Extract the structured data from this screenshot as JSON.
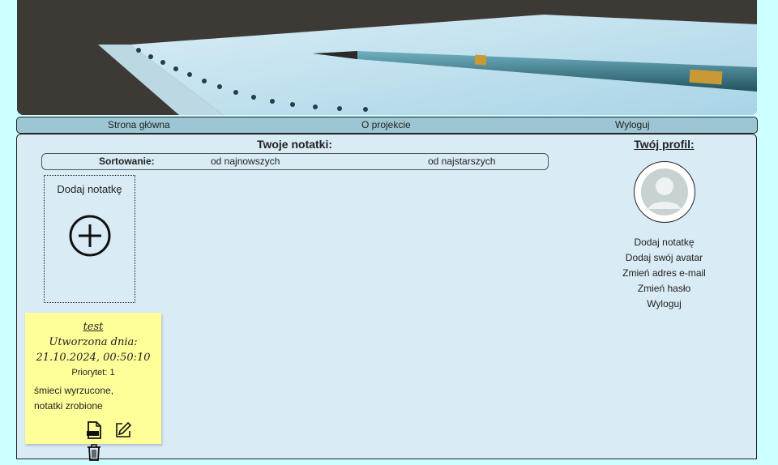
{
  "nav": {
    "home": "Strona główna",
    "about": "O projekcie",
    "logout": "Wyloguj"
  },
  "notes_section": {
    "title": "Twoje notatki:",
    "sort_label": "Sortowanie:",
    "sort_newest": "od najnowszych",
    "sort_oldest": "od najstarszych",
    "add_note_label": "Dodaj notatkę"
  },
  "notes": [
    {
      "title": "test",
      "created_label": "Utworzona dnia:",
      "created_at": "21.10.2024, 00:50:10",
      "priority": "Priorytet: 1",
      "content_line1": "śmieci wyrzucone,",
      "content_line2": "notatki zrobione",
      "actions": [
        "pdf-icon",
        "edit-icon",
        "trash-icon"
      ]
    }
  ],
  "profile": {
    "title": "Twój profil:",
    "links": [
      "Dodaj notatkę",
      "Dodaj swój avatar",
      "Zmień adres e-mail",
      "Zmień hasło",
      "Wyloguj"
    ]
  },
  "colors": {
    "page_bg": "#ccffff",
    "nav_bg": "#9cc6d4",
    "panel_bg": "#d9ebf4",
    "note_bg": "#ffff99"
  }
}
